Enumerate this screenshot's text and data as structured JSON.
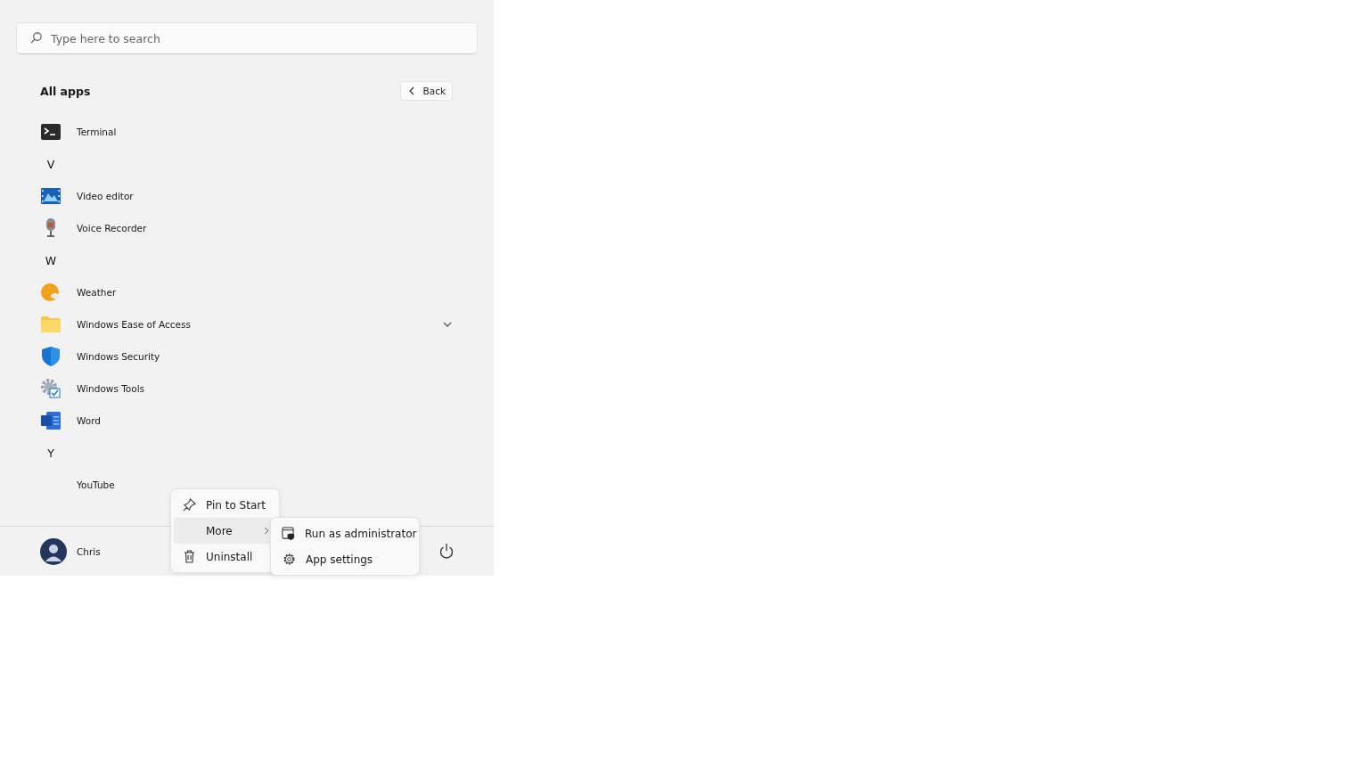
{
  "search": {
    "placeholder": "Type here to search"
  },
  "header": {
    "title": "All apps",
    "back_button": "Back"
  },
  "apps": [
    {
      "kind": "app",
      "label": "Terminal"
    },
    {
      "kind": "letter",
      "label": "V"
    },
    {
      "kind": "app",
      "label": "Video editor"
    },
    {
      "kind": "app",
      "label": "Voice Recorder"
    },
    {
      "kind": "letter",
      "label": "W"
    },
    {
      "kind": "app",
      "label": "Weather"
    },
    {
      "kind": "folder",
      "label": "Windows Ease of Access",
      "expanded": false
    },
    {
      "kind": "app",
      "label": "Windows Security"
    },
    {
      "kind": "app",
      "label": "Windows Tools"
    },
    {
      "kind": "app",
      "label": "Word"
    },
    {
      "kind": "letter",
      "label": "Y"
    },
    {
      "kind": "app",
      "label": "YouTube"
    }
  ],
  "context_menu": {
    "items": [
      {
        "label": "Pin to Start",
        "selected": false,
        "submenu": false
      },
      {
        "label": "More",
        "selected": true,
        "submenu": true
      },
      {
        "label": "Uninstall",
        "selected": false,
        "submenu": false
      }
    ],
    "submenu": [
      {
        "label": "Run as administrator"
      },
      {
        "label": "App settings"
      }
    ]
  },
  "footer": {
    "user": "Chris"
  }
}
